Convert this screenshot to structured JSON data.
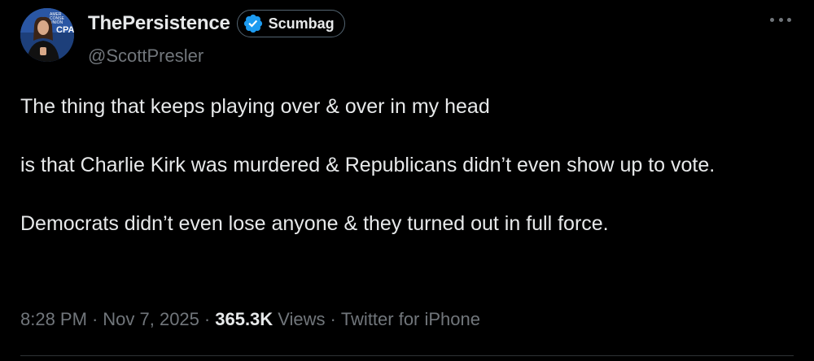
{
  "author": {
    "display_name": "ThePersistence",
    "handle": "@ScottPresler",
    "affiliation_label": "Scumbag",
    "verified": true,
    "avatar_text": [
      "AMER",
      "CONSE",
      "UNION",
      "CPA"
    ]
  },
  "tweet": {
    "text": "The thing that keeps playing over & over in my head\n\nis that Charlie Kirk was murdered & Republicans didn’t even show up to vote.\n\nDemocrats didn’t even lose anyone & they turned out in full force."
  },
  "meta": {
    "time": "8:28 PM",
    "sep1": "·",
    "date": "Nov 7, 2025",
    "sep2": "·",
    "views_count": "365.3K",
    "views_label": "Views",
    "sep3": "·",
    "source": "Twitter for iPhone"
  },
  "colors": {
    "background": "#000000",
    "text_primary": "#e7e9ea",
    "text_secondary": "#71767b",
    "verified_blue": "#1d9bf0"
  },
  "icons": {
    "verified": "verified-badge-icon",
    "more": "more-options-icon"
  }
}
